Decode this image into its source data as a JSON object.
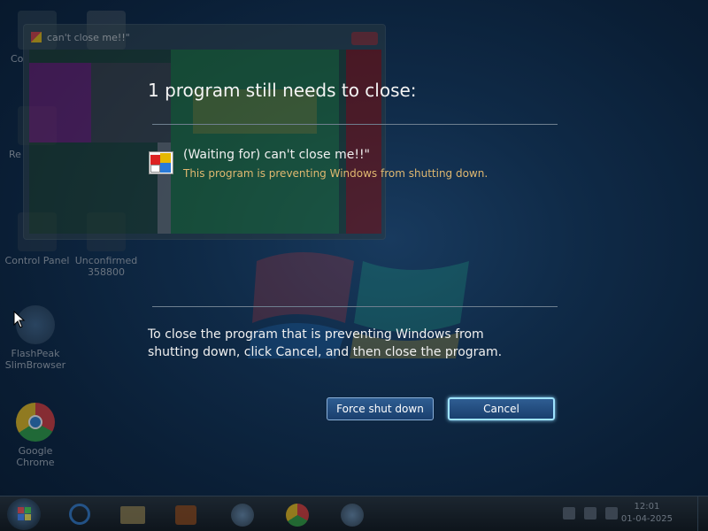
{
  "background_window": {
    "title": "can't close me!!\""
  },
  "desktop_icons": [
    {
      "label": "Co",
      "icon": "computer-icon"
    },
    {
      "label": "Re",
      "icon": "recycle-bin-icon"
    },
    {
      "label": "Control Panel",
      "icon": "control-panel-icon"
    },
    {
      "label": "Unconfirmed 358800",
      "icon": "download-file-icon"
    },
    {
      "label": "FlashPeak SlimBrowser",
      "icon": "slimbrowser-icon"
    },
    {
      "label": "Google Chrome",
      "icon": "chrome-icon"
    }
  ],
  "dialog": {
    "headline": "1 program still needs to close:",
    "program_title": "(Waiting for) can't close me!!\"",
    "program_subtitle": "This program is preventing Windows from shutting down.",
    "instructions": "To close the program that is preventing Windows from shutting down, click Cancel, and then close the program.",
    "force_label": "Force shut down",
    "cancel_label": "Cancel"
  },
  "taskbar": {
    "apps": [
      "start-orb",
      "internet-explorer",
      "windows-explorer",
      "media-player",
      "slimbrowser",
      "chrome",
      "slimbrowser-2"
    ],
    "time": "12:01",
    "date": "01-04-2025"
  },
  "colors": {
    "accent_warning": "#e0b870",
    "button_focus": "#9ee3ff"
  }
}
